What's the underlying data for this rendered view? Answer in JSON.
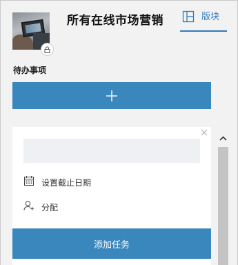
{
  "header": {
    "title": "所有在线市场营销",
    "board_tab_label": "版块",
    "avatar_icon": "group-photo",
    "lock_icon": "lock-icon",
    "board_icon": "board-layout-icon"
  },
  "section": {
    "title": "待办事项",
    "add_button_symbol": "+"
  },
  "task_card": {
    "input_value": "",
    "input_placeholder": "",
    "close_icon": "close-icon",
    "due_date_label": "设置截止日期",
    "assign_label": "分配",
    "submit_label": "添加任务"
  },
  "colors": {
    "accent": "#3a87bd",
    "tab_accent": "#2e7bbf",
    "background": "#f2f2f2",
    "input_bg": "#eef0f3"
  }
}
